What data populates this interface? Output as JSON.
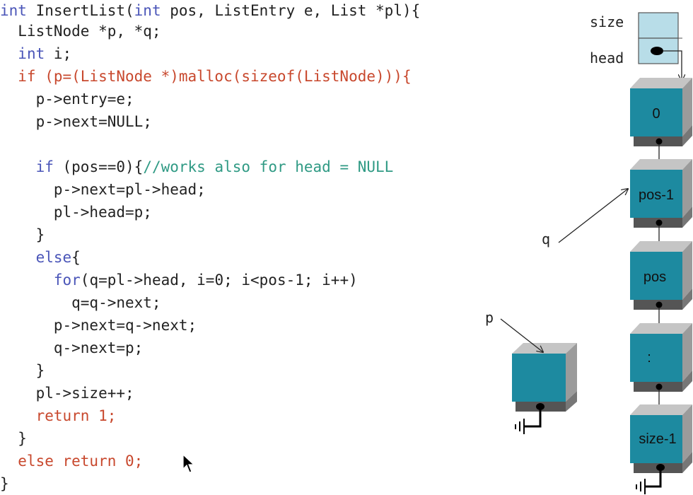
{
  "code": {
    "lines": [
      {
        "parts": [
          {
            "t": "int",
            "c": "kw"
          },
          {
            "t": " InsertList("
          },
          {
            "t": "int",
            "c": "kw"
          },
          {
            "t": " pos, ListEntry e, List *pl){"
          }
        ]
      },
      {
        "parts": [
          {
            "t": "  ListNode *p, *q;"
          }
        ]
      },
      {
        "parts": [
          {
            "t": "  "
          },
          {
            "t": "int",
            "c": "kw"
          },
          {
            "t": " i;"
          }
        ]
      },
      {
        "parts": [
          {
            "t": "  if (p=(ListNode *)malloc(sizeof(ListNode))){",
            "c": "red"
          }
        ]
      },
      {
        "parts": [
          {
            "t": "    p->entry=e;"
          }
        ]
      },
      {
        "parts": [
          {
            "t": "    p->next=NULL;"
          }
        ]
      },
      {
        "parts": [
          {
            "t": ""
          }
        ]
      },
      {
        "parts": [
          {
            "t": "    "
          },
          {
            "t": "if",
            "c": "kw"
          },
          {
            "t": " (pos==0){"
          },
          {
            "t": "//works also for head = NULL",
            "c": "cm"
          }
        ]
      },
      {
        "parts": [
          {
            "t": "      p->next=pl->head;"
          }
        ]
      },
      {
        "parts": [
          {
            "t": "      pl->head=p;"
          }
        ]
      },
      {
        "parts": [
          {
            "t": "    }"
          }
        ]
      },
      {
        "parts": [
          {
            "t": "    "
          },
          {
            "t": "else",
            "c": "kw"
          },
          {
            "t": "{"
          }
        ]
      },
      {
        "parts": [
          {
            "t": "      "
          },
          {
            "t": "for",
            "c": "kw"
          },
          {
            "t": "(q=pl->head, i=0; i<pos-1; i++)"
          }
        ]
      },
      {
        "parts": [
          {
            "t": "        q=q->next;"
          }
        ]
      },
      {
        "parts": [
          {
            "t": "      p->next=q->next;"
          }
        ]
      },
      {
        "parts": [
          {
            "t": "      q->next=p;"
          }
        ]
      },
      {
        "parts": [
          {
            "t": "    }"
          }
        ]
      },
      {
        "parts": [
          {
            "t": "    pl->size++;"
          }
        ]
      },
      {
        "parts": [
          {
            "t": "    return 1;",
            "c": "red"
          }
        ]
      },
      {
        "parts": [
          {
            "t": "  }"
          }
        ]
      },
      {
        "parts": [
          {
            "t": "  else return 0;",
            "c": "red"
          }
        ]
      },
      {
        "parts": [
          {
            "t": "}"
          }
        ]
      }
    ]
  },
  "diagram": {
    "list_header": {
      "size_label": "size",
      "head_label": "head"
    },
    "nodes": [
      {
        "label": "0"
      },
      {
        "label": "pos-1"
      },
      {
        "label": "pos"
      },
      {
        "label": ":"
      },
      {
        "label": "size-1"
      }
    ],
    "pointer_q": "q",
    "pointer_p": "p"
  },
  "colors": {
    "keyword": "#4a55b8",
    "highlight": "#c8482d",
    "comment": "#2f9a84",
    "node_face": "#1d8aa0",
    "node_side": "#9b9b9b",
    "header_fill": "#b8dde8"
  }
}
